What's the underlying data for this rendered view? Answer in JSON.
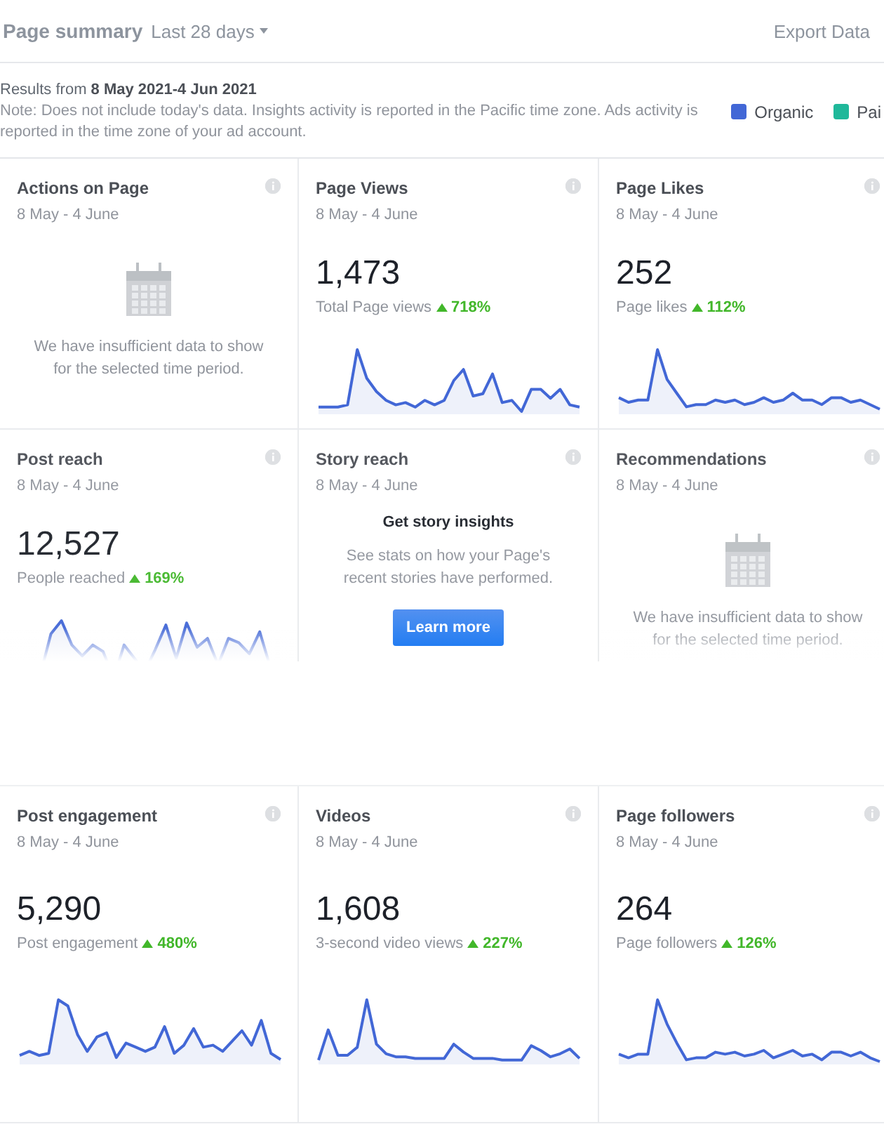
{
  "header": {
    "title": "Page summary",
    "period": "Last 28 days",
    "export": "Export Data"
  },
  "notes": {
    "results_label": "Results from",
    "results_range": "8 May 2021-4 Jun 2021",
    "note": "Note: Does not include today's data. Insights activity is reported in the Pacific time zone. Ads activity is reported in the time zone of your ad account."
  },
  "legend": [
    {
      "label": "Organic",
      "color": "#4267d6"
    },
    {
      "label": "Pai",
      "color": "#1fb89a"
    }
  ],
  "cards": [
    {
      "kind": "empty",
      "title": "Actions on Page",
      "date": "8 May - 4 June",
      "message": "We have insufficient data to show for the selected time period."
    },
    {
      "kind": "stat",
      "title": "Page Views",
      "date": "8 May - 4 June",
      "value": "1,473",
      "caption": "Total Page views",
      "change": "718%"
    },
    {
      "kind": "stat",
      "title": "Page Likes",
      "date": "8 May - 4 June",
      "value": "252",
      "caption": "Page likes",
      "change": "112%"
    },
    {
      "kind": "stat",
      "title": "Post reach",
      "date": "8 May - 4 June",
      "value": "12,527",
      "caption": "People reached",
      "change": "169%"
    },
    {
      "kind": "story",
      "title": "Story reach",
      "date": "8 May - 4 June",
      "heading": "Get story insights",
      "message": "See stats on how your Page's recent stories have performed.",
      "button": "Learn more"
    },
    {
      "kind": "empty",
      "title": "Recommendations",
      "date": "8 May - 4 June",
      "message": "We have insufficient data to show for the selected time period."
    },
    {
      "kind": "stat",
      "title": "Post engagement",
      "date": "8 May - 4 June",
      "value": "5,290",
      "caption": "Post engagement",
      "change": "480%"
    },
    {
      "kind": "stat",
      "title": "Videos",
      "date": "8 May - 4 June",
      "value": "1,608",
      "caption": "3-second video views",
      "change": "227%"
    },
    {
      "kind": "stat",
      "title": "Page followers",
      "date": "8 May - 4 June",
      "value": "264",
      "caption": "Page followers",
      "change": "126%"
    }
  ]
}
